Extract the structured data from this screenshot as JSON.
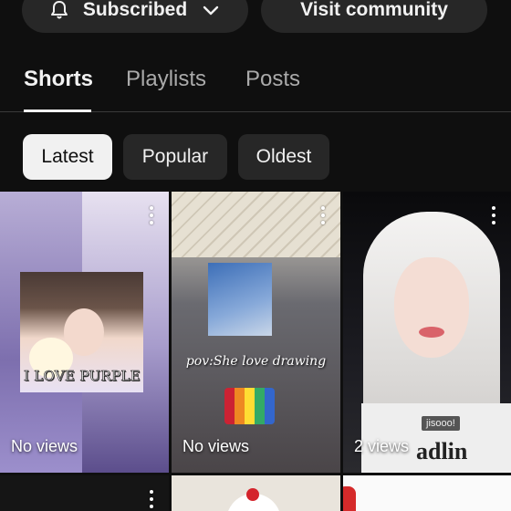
{
  "header": {
    "subscribed_label": "Subscribed",
    "visit_label": "Visit community"
  },
  "tabs": [
    {
      "label": "Shorts",
      "active": true
    },
    {
      "label": "Playlists",
      "active": false
    },
    {
      "label": "Posts",
      "active": false
    }
  ],
  "filters": [
    {
      "label": "Latest",
      "selected": true
    },
    {
      "label": "Popular",
      "selected": false
    },
    {
      "label": "Oldest",
      "selected": false
    }
  ],
  "shorts": [
    {
      "views": "No views",
      "overlay_text": "I LOVE PURPLE"
    },
    {
      "views": "No views",
      "overlay_text": "pov:She love drawing"
    },
    {
      "views": "2 views",
      "overlay_text": "jisooo!"
    }
  ],
  "colors": {
    "background": "#0f0f0f",
    "chip_bg": "#272727",
    "chip_selected_bg": "#f1f1f1",
    "text_primary": "#f1f1f1",
    "text_secondary": "#aaaaaa"
  },
  "icons": {
    "subscribed": "bell-icon",
    "dropdown": "chevron-down-icon",
    "more": "more-vert-icon"
  }
}
